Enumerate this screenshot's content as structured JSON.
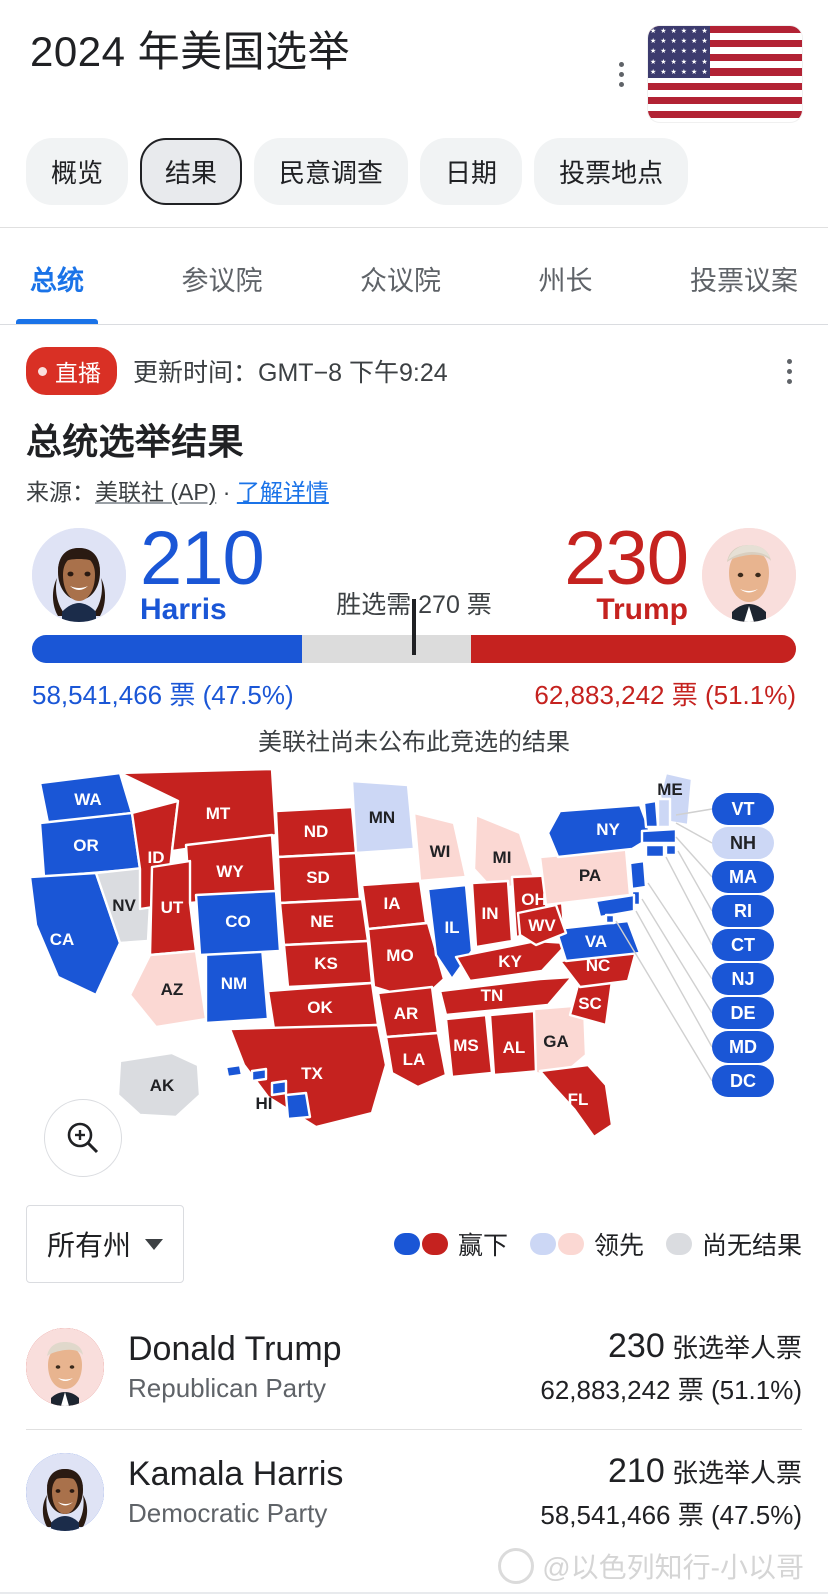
{
  "header": {
    "title": "2024 年美国选举",
    "menu_icon": "kebab-menu-icon",
    "flag_icon": "us-flag-icon"
  },
  "pills": [
    {
      "label": "概览",
      "active": false
    },
    {
      "label": "结果",
      "active": true
    },
    {
      "label": "民意调查",
      "active": false
    },
    {
      "label": "日期",
      "active": false
    },
    {
      "label": "投票地点",
      "active": false
    }
  ],
  "tabs": [
    {
      "label": "总统",
      "active": true
    },
    {
      "label": "参议院",
      "active": false
    },
    {
      "label": "众议院",
      "active": false
    },
    {
      "label": "州长",
      "active": false
    },
    {
      "label": "投票议案",
      "active": false
    }
  ],
  "live": {
    "badge": "直播",
    "updated": "更新时间：GMT−8 下午9:24",
    "menu_icon": "kebab-menu-icon"
  },
  "result": {
    "title": "总统选举结果",
    "source_prefix": "来源：",
    "source_name": "美联社 (AP)",
    "source_sep": " · ",
    "source_link": "了解详情",
    "threshold_label": "胜选需 270 票",
    "notice": "美联社尚未公布此竞选的结果"
  },
  "scoreboard": {
    "left": {
      "electoral": "210",
      "name": "Harris",
      "votes": "58,541,466 票 (47.5%)",
      "color": "#1a56d6",
      "bar_pct": 35.4,
      "avatar": "harris-avatar"
    },
    "right": {
      "electoral": "230",
      "name": "Trump",
      "votes": "62,883,242 票 (51.1%)",
      "color": "#c5221f",
      "bar_pct": 42.6,
      "avatar": "trump-avatar"
    },
    "threshold_pct": 50
  },
  "map": {
    "zoom_icon": "zoom-in-icon",
    "states": [
      {
        "code": "WA",
        "status": "dem-win"
      },
      {
        "code": "OR",
        "status": "dem-win"
      },
      {
        "code": "CA",
        "status": "dem-win"
      },
      {
        "code": "NV",
        "status": "no-result"
      },
      {
        "code": "ID",
        "status": "rep-win"
      },
      {
        "code": "MT",
        "status": "rep-win"
      },
      {
        "code": "WY",
        "status": "rep-win"
      },
      {
        "code": "UT",
        "status": "rep-win"
      },
      {
        "code": "AZ",
        "status": "rep-lead"
      },
      {
        "code": "NM",
        "status": "dem-win"
      },
      {
        "code": "CO",
        "status": "dem-win"
      },
      {
        "code": "ND",
        "status": "rep-win"
      },
      {
        "code": "SD",
        "status": "rep-win"
      },
      {
        "code": "NE",
        "status": "rep-win"
      },
      {
        "code": "KS",
        "status": "rep-win"
      },
      {
        "code": "OK",
        "status": "rep-win"
      },
      {
        "code": "TX",
        "status": "rep-win"
      },
      {
        "code": "MN",
        "status": "dem-lead"
      },
      {
        "code": "IA",
        "status": "rep-win"
      },
      {
        "code": "MO",
        "status": "rep-win"
      },
      {
        "code": "AR",
        "status": "rep-win"
      },
      {
        "code": "LA",
        "status": "rep-win"
      },
      {
        "code": "WI",
        "status": "rep-lead"
      },
      {
        "code": "IL",
        "status": "dem-win"
      },
      {
        "code": "MI",
        "status": "rep-lead"
      },
      {
        "code": "IN",
        "status": "rep-win"
      },
      {
        "code": "OH",
        "status": "rep-win"
      },
      {
        "code": "KY",
        "status": "rep-win"
      },
      {
        "code": "TN",
        "status": "rep-win"
      },
      {
        "code": "MS",
        "status": "rep-win"
      },
      {
        "code": "AL",
        "status": "rep-win"
      },
      {
        "code": "GA",
        "status": "rep-lead"
      },
      {
        "code": "FL",
        "status": "rep-win"
      },
      {
        "code": "SC",
        "status": "rep-win"
      },
      {
        "code": "NC",
        "status": "rep-win"
      },
      {
        "code": "VA",
        "status": "dem-win"
      },
      {
        "code": "WV",
        "status": "rep-win"
      },
      {
        "code": "PA",
        "status": "rep-lead"
      },
      {
        "code": "NY",
        "status": "dem-win"
      },
      {
        "code": "ME",
        "status": "dem-lead"
      },
      {
        "code": "AK",
        "status": "no-result"
      },
      {
        "code": "HI",
        "status": "dem-win"
      }
    ],
    "badges": [
      {
        "code": "VT",
        "status": "dem-win"
      },
      {
        "code": "NH",
        "status": "dem-lead"
      },
      {
        "code": "MA",
        "status": "dem-win"
      },
      {
        "code": "RI",
        "status": "dem-win"
      },
      {
        "code": "CT",
        "status": "dem-win"
      },
      {
        "code": "NJ",
        "status": "dem-win"
      },
      {
        "code": "DE",
        "status": "dem-win"
      },
      {
        "code": "MD",
        "status": "dem-win"
      },
      {
        "code": "DC",
        "status": "dem-win"
      }
    ]
  },
  "controls": {
    "state_filter": "所有州",
    "legend": [
      {
        "label": "赢下",
        "swatches": [
          "#1a56d6",
          "#c5221f"
        ]
      },
      {
        "label": "领先",
        "swatches": [
          "#ccd7f5",
          "#fbd8d3"
        ]
      },
      {
        "label": "尚无结果",
        "swatches": [
          "#dadce0"
        ]
      }
    ]
  },
  "candidate_rows": [
    {
      "name": "Donald Trump",
      "party": "Republican Party",
      "electoral": "230",
      "electoral_unit": "张选举人票",
      "votes": "62,883,242 票 (51.1%)",
      "accent": "#c5221f",
      "avatar": "trump-avatar"
    },
    {
      "name": "Kamala Harris",
      "party": "Democratic Party",
      "electoral": "210",
      "electoral_unit": "张选举人票",
      "votes": "58,541,466 票 (47.5%)",
      "accent": "#1a56d6",
      "avatar": "harris-avatar"
    }
  ],
  "watermark": {
    "text": "@以色列知行-小以哥",
    "logo": "weibo-logo-icon"
  },
  "colors": {
    "dem_win": "#1a56d6",
    "rep_win": "#c5221f",
    "dem_lead": "#ccd7f5",
    "rep_lead": "#fbd8d3",
    "no_result": "#dadce0",
    "accent_link": "#1a73e8",
    "live_red": "#d93025"
  }
}
